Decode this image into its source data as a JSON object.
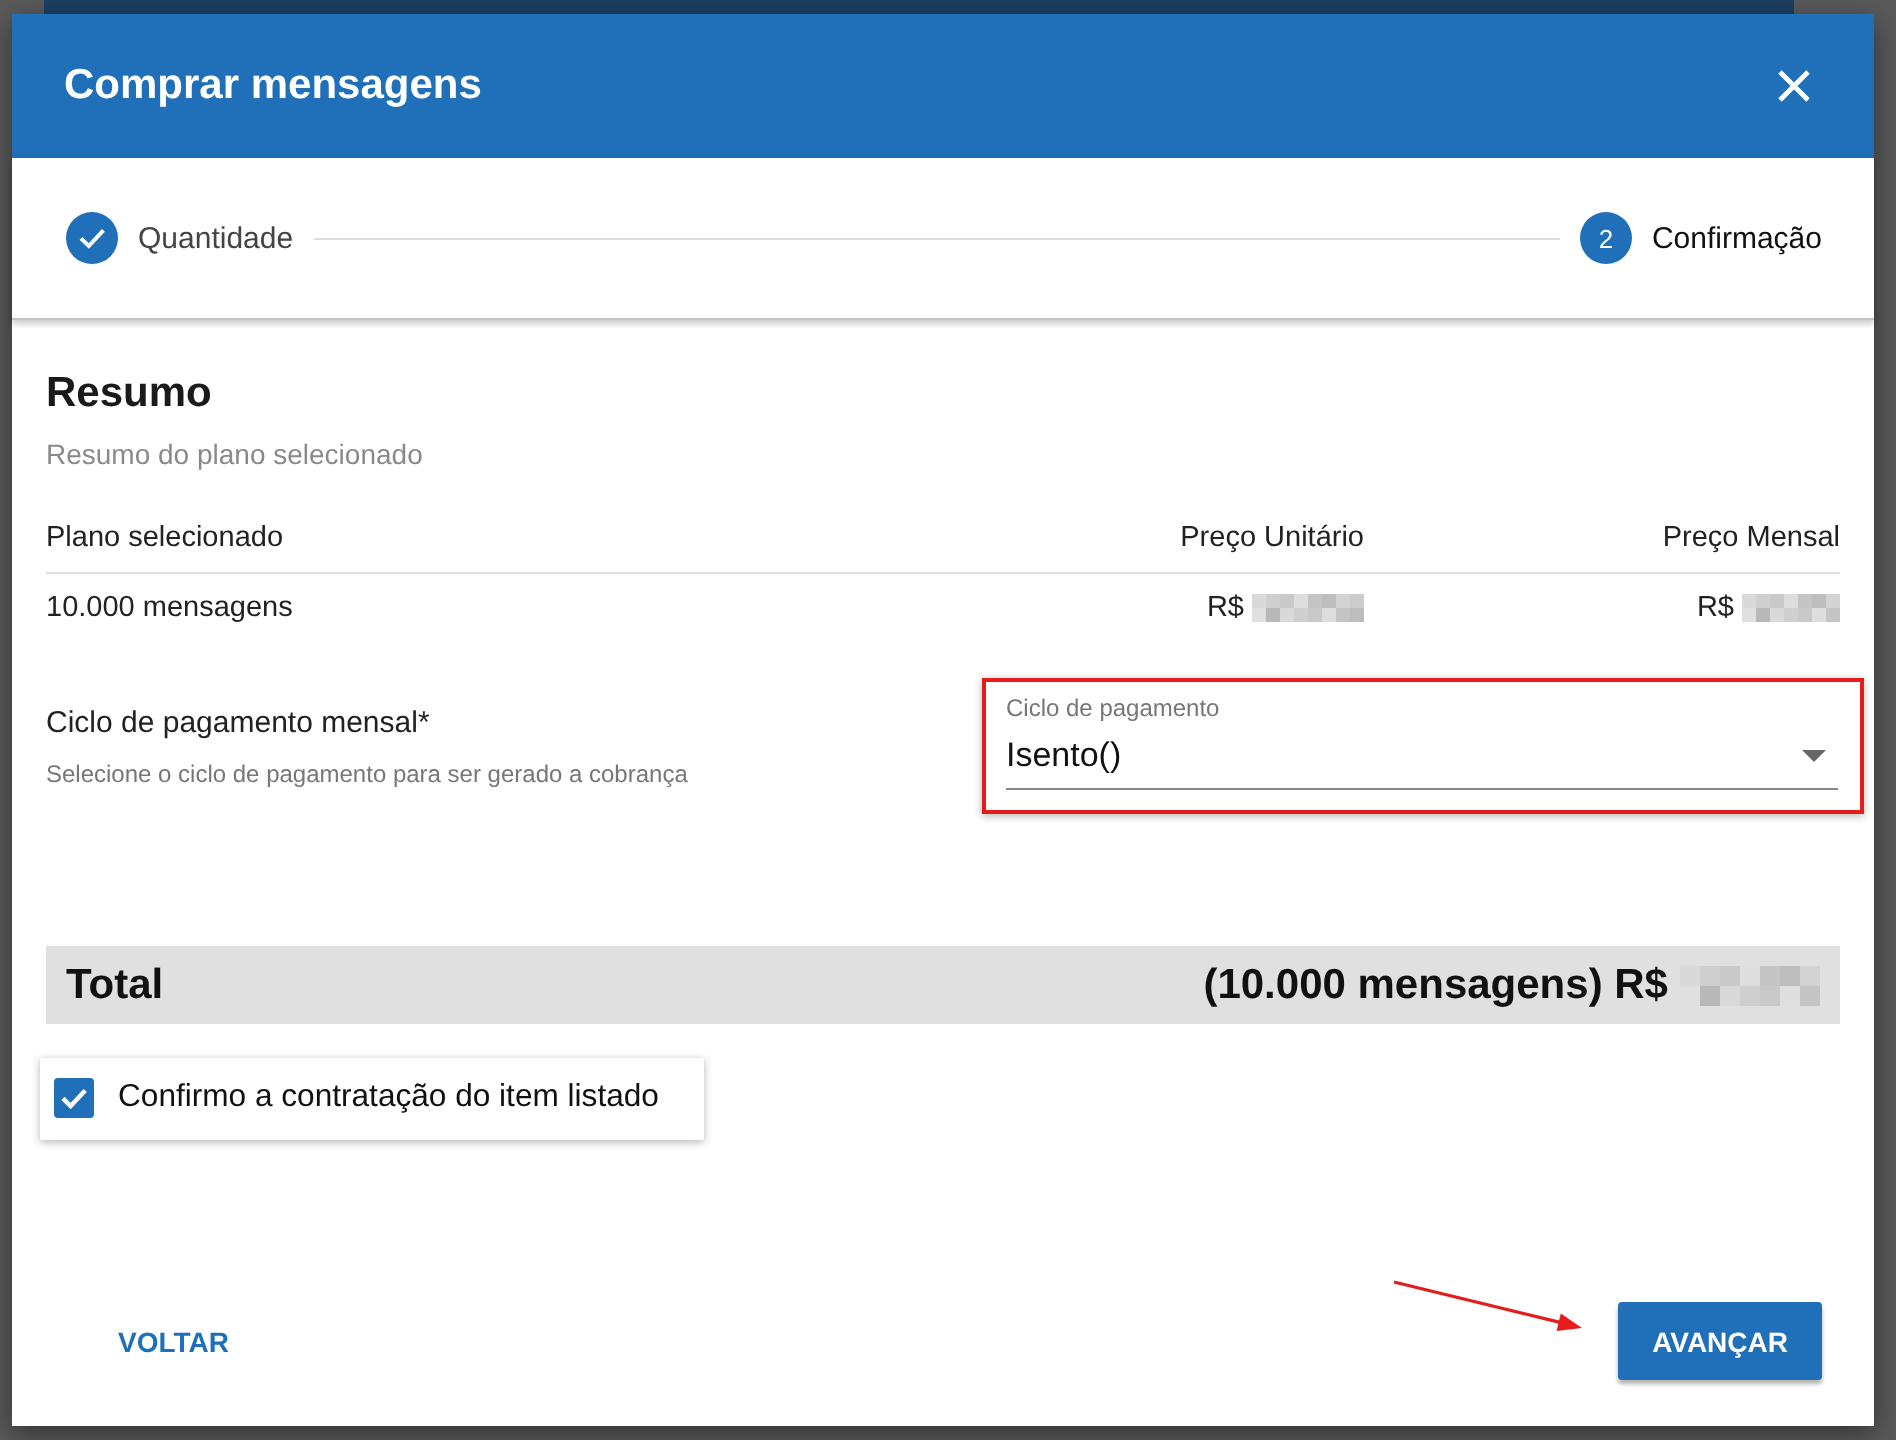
{
  "dialog": {
    "title": "Comprar mensagens"
  },
  "stepper": {
    "steps": [
      {
        "label": "Quantidade",
        "completed": true,
        "selected": false
      },
      {
        "label": "Confirmação",
        "number": "2",
        "completed": false,
        "selected": true
      }
    ]
  },
  "summary": {
    "title": "Resumo",
    "subtitle": "Resumo do plano selecionado",
    "columns": [
      "Plano selecionado",
      "Preço Unitário",
      "Preço Mensal"
    ],
    "rows": [
      {
        "plan": "10.000 mensagens",
        "unit_price": {
          "currency": "R$",
          "redacted": true
        },
        "monthly_price": {
          "currency": "R$",
          "redacted": true
        }
      }
    ]
  },
  "payment_cycle": {
    "label": "Ciclo de pagamento mensal*",
    "hint": "Selecione o ciclo de pagamento para ser gerado a cobrança",
    "select": {
      "label": "Ciclo de pagamento",
      "value": "Isento()",
      "annotated": true
    }
  },
  "total": {
    "label": "Total",
    "amount": {
      "text": "(10.000 mensagens) R$",
      "redacted": true
    }
  },
  "confirmation": {
    "label": "Confirmo a contratação do item listado",
    "checked": true,
    "annotated": true
  },
  "footer": {
    "back": "VOLTAR",
    "next": {
      "label": "AVANÇAR",
      "annotated": true
    }
  }
}
